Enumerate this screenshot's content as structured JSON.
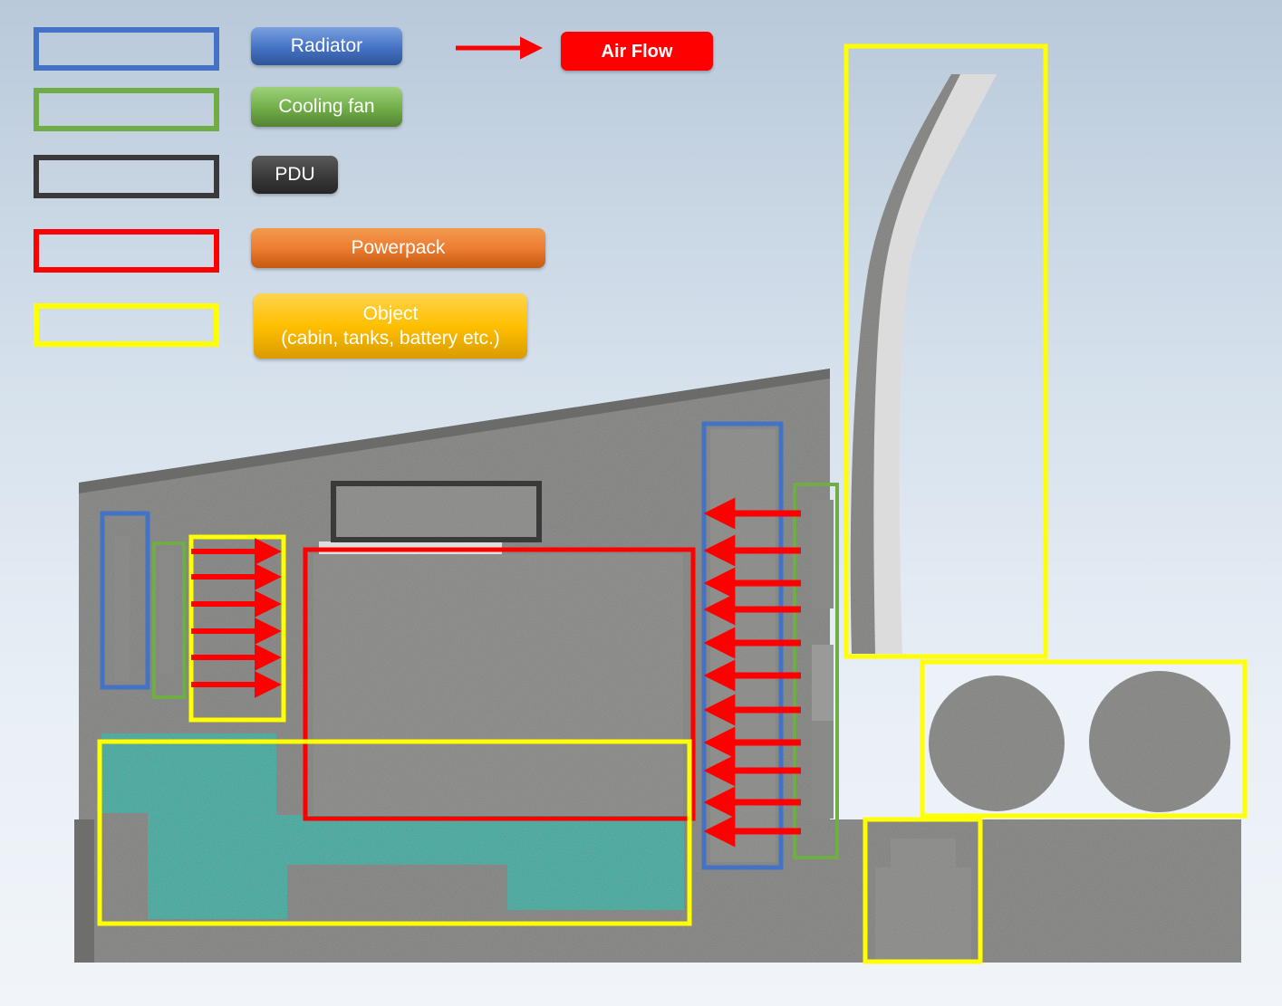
{
  "colors": {
    "radiator": "#4472c4",
    "cooling_fan": "#70ad47",
    "pdu": "#3a3a3a",
    "powerpack": "#ff0000",
    "object": "#ffff00",
    "air_flow": "#ff0000",
    "grey_body": "#7a7a78",
    "teal_fill": "#1aa89e",
    "duct": "#d9d9d9"
  },
  "legend": {
    "radiator_label": "Radiator",
    "cooling_fan_label": "Cooling fan",
    "pdu_label": "PDU",
    "powerpack_label": "Powerpack",
    "object_label_line1": "Object",
    "object_label_line2": "(cabin, tanks, battery etc.)",
    "air_flow_label": "Air Flow"
  }
}
